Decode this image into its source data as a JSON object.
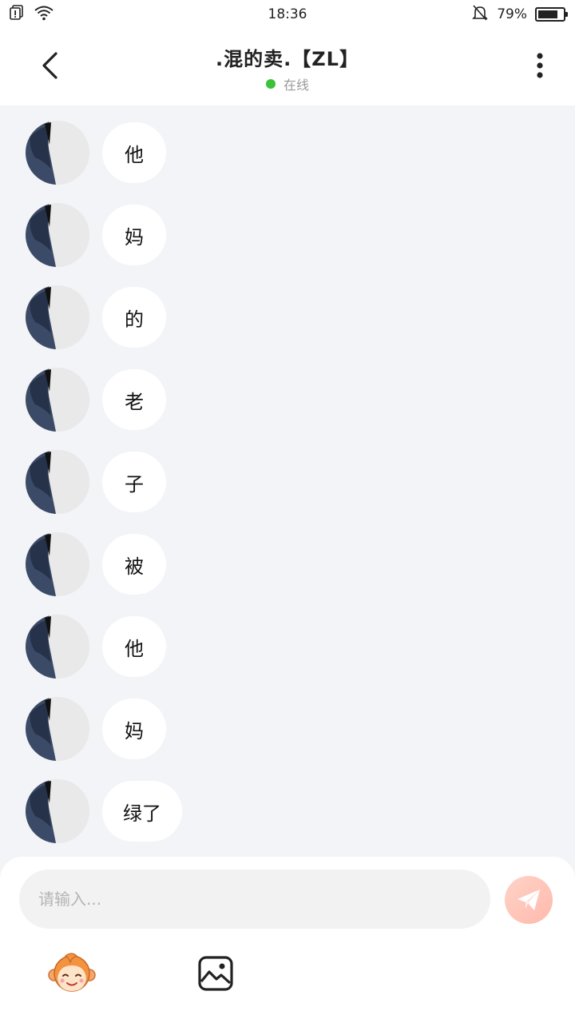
{
  "status_bar": {
    "time": "18:36",
    "battery_percent": "79%",
    "battery_level": 0.79,
    "icons": [
      "alert-sim-icon",
      "wifi-icon",
      "silent-bell-icon",
      "battery-icon"
    ]
  },
  "header": {
    "title": ".混的卖.【ZL】",
    "presence": "在线",
    "presence_color": "#39c23a",
    "back_icon": "chevron-left-icon",
    "more_icon": "more-vertical-icon"
  },
  "messages": [
    {
      "text": "他"
    },
    {
      "text": "妈"
    },
    {
      "text": "的"
    },
    {
      "text": "老"
    },
    {
      "text": "子"
    },
    {
      "text": "被"
    },
    {
      "text": "他"
    },
    {
      "text": "妈"
    },
    {
      "text": "绿了"
    }
  ],
  "composer": {
    "placeholder": "请输入...",
    "value": "",
    "send_icon": "paper-plane-icon",
    "tools": [
      "emoji-monkey-icon",
      "image-icon"
    ]
  }
}
